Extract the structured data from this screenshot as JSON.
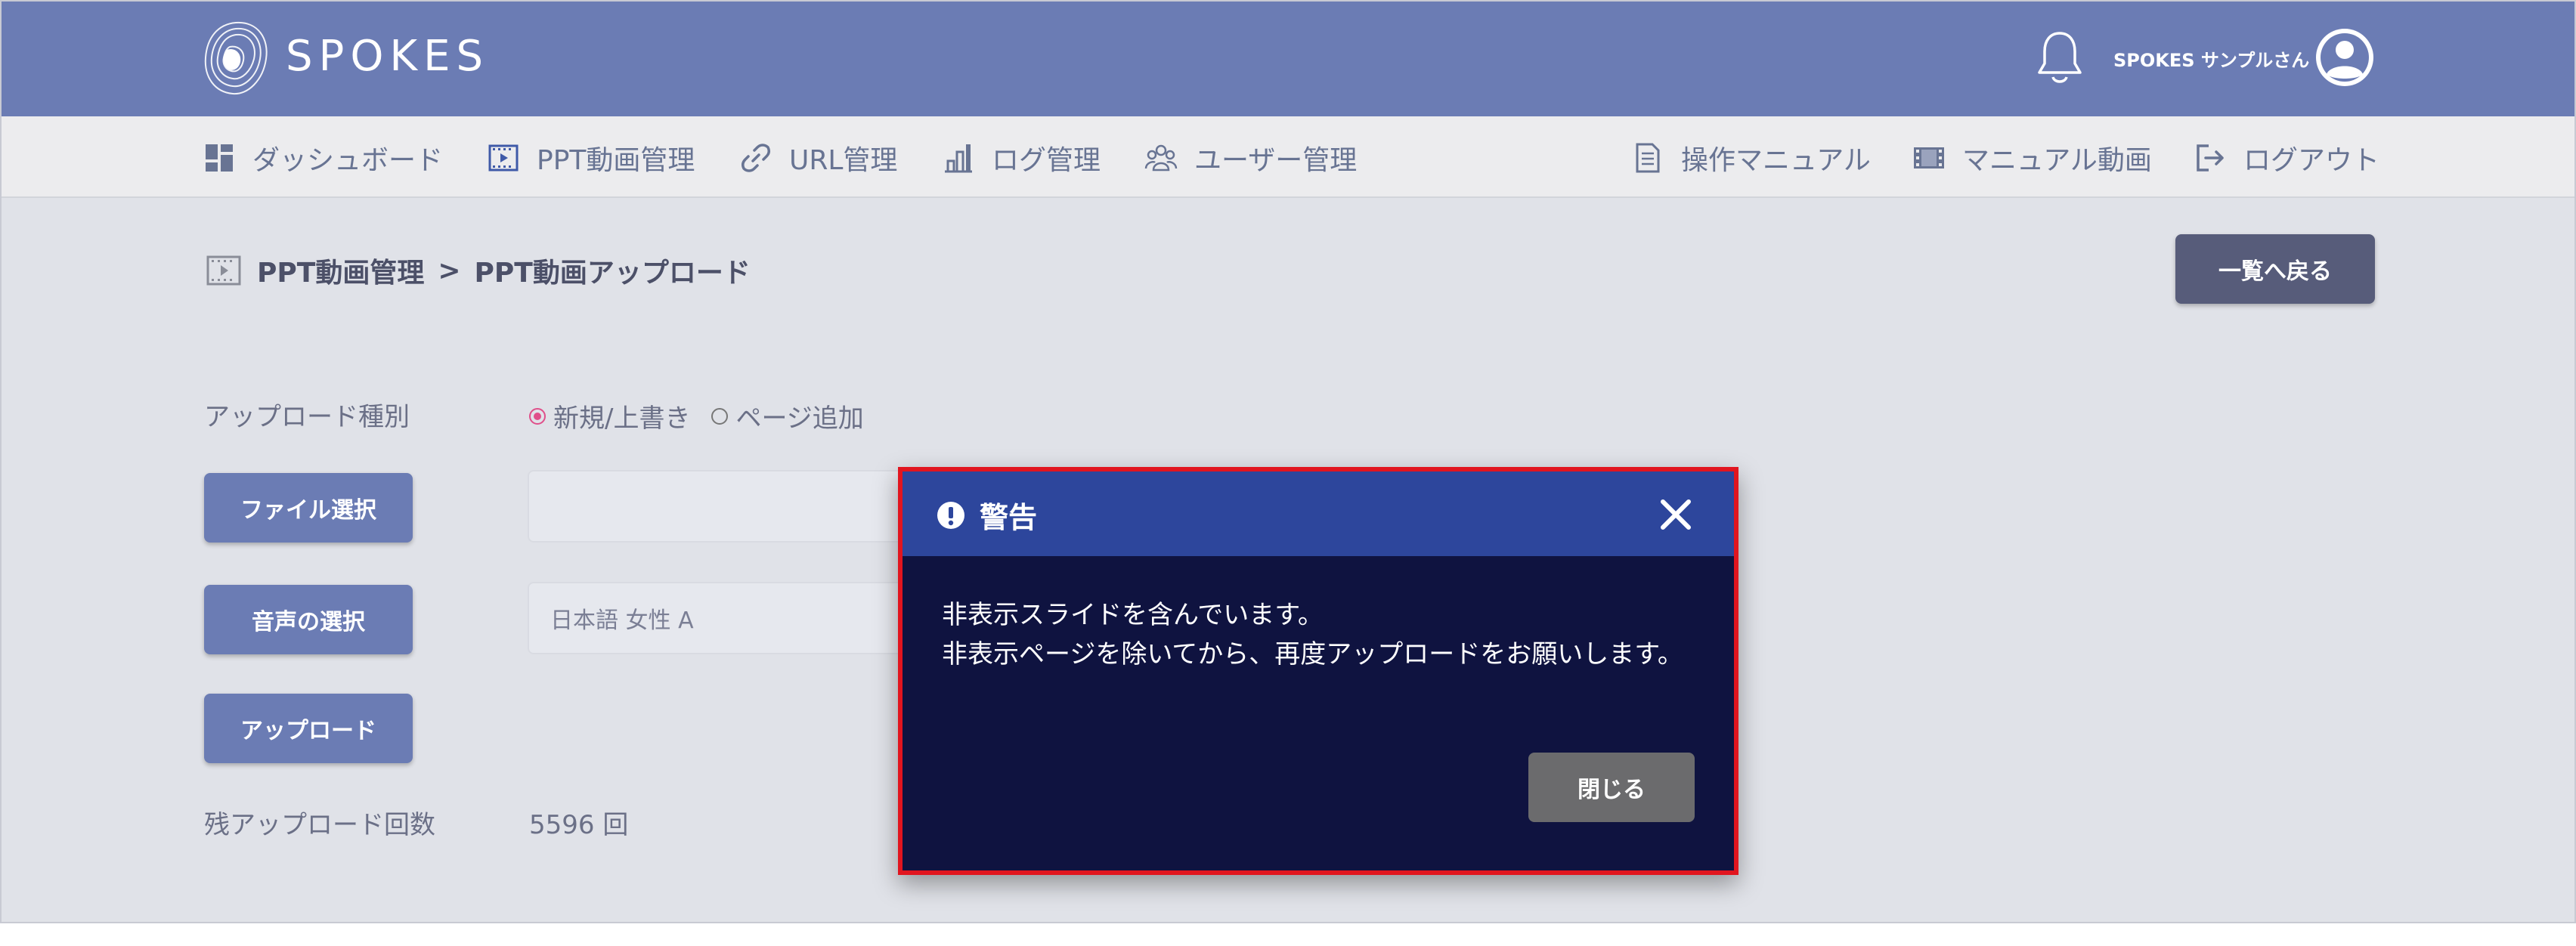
{
  "header": {
    "brand": "SPOKES",
    "user_name": "SPOKES サンプルさん",
    "icons": {
      "notification": "bell-icon",
      "user": "user-circle-icon"
    }
  },
  "nav": {
    "left": [
      {
        "label": "ダッシュボード",
        "icon": "dashboard-icon"
      },
      {
        "label": "PPT動画管理",
        "icon": "film-icon"
      },
      {
        "label": "URL管理",
        "icon": "link-icon"
      },
      {
        "label": "ログ管理",
        "icon": "log-chart-icon"
      },
      {
        "label": "ユーザー管理",
        "icon": "users-icon"
      }
    ],
    "right": [
      {
        "label": "操作マニュアル",
        "icon": "document-icon"
      },
      {
        "label": "マニュアル動画",
        "icon": "video-icon"
      },
      {
        "label": "ログアウト",
        "icon": "logout-icon"
      }
    ]
  },
  "page": {
    "breadcrumb": [
      "PPT動画管理",
      "PPT動画アップロード"
    ],
    "breadcrumb_separator": ">",
    "back_button": "一覧へ戻る"
  },
  "form": {
    "upload_type_label": "アップロード種別",
    "upload_type_options": [
      "新規/上書き",
      "ページ追加"
    ],
    "upload_type_selected": "新規/上書き",
    "file_button": "ファイル選択",
    "file_value": "",
    "voice_button": "音声の選択",
    "voice_value": "日本語 女性 A",
    "upload_button": "アップロード",
    "remaining_label": "残アップロード回数",
    "remaining_value": "5596 回"
  },
  "modal": {
    "title": "警告",
    "message_line1": "非表示スライドを含んでいます。",
    "message_line2": "非表示ページを除いてから、再度アップロードをお願いします。",
    "close_button": "閉じる",
    "colors": {
      "header": "#2d469c",
      "body": "#0f1340",
      "highlight_border": "#e1151f"
    }
  },
  "colors": {
    "brand": "#6b7cb4",
    "background": "#e0e2e8",
    "nav_text": "#687493"
  }
}
